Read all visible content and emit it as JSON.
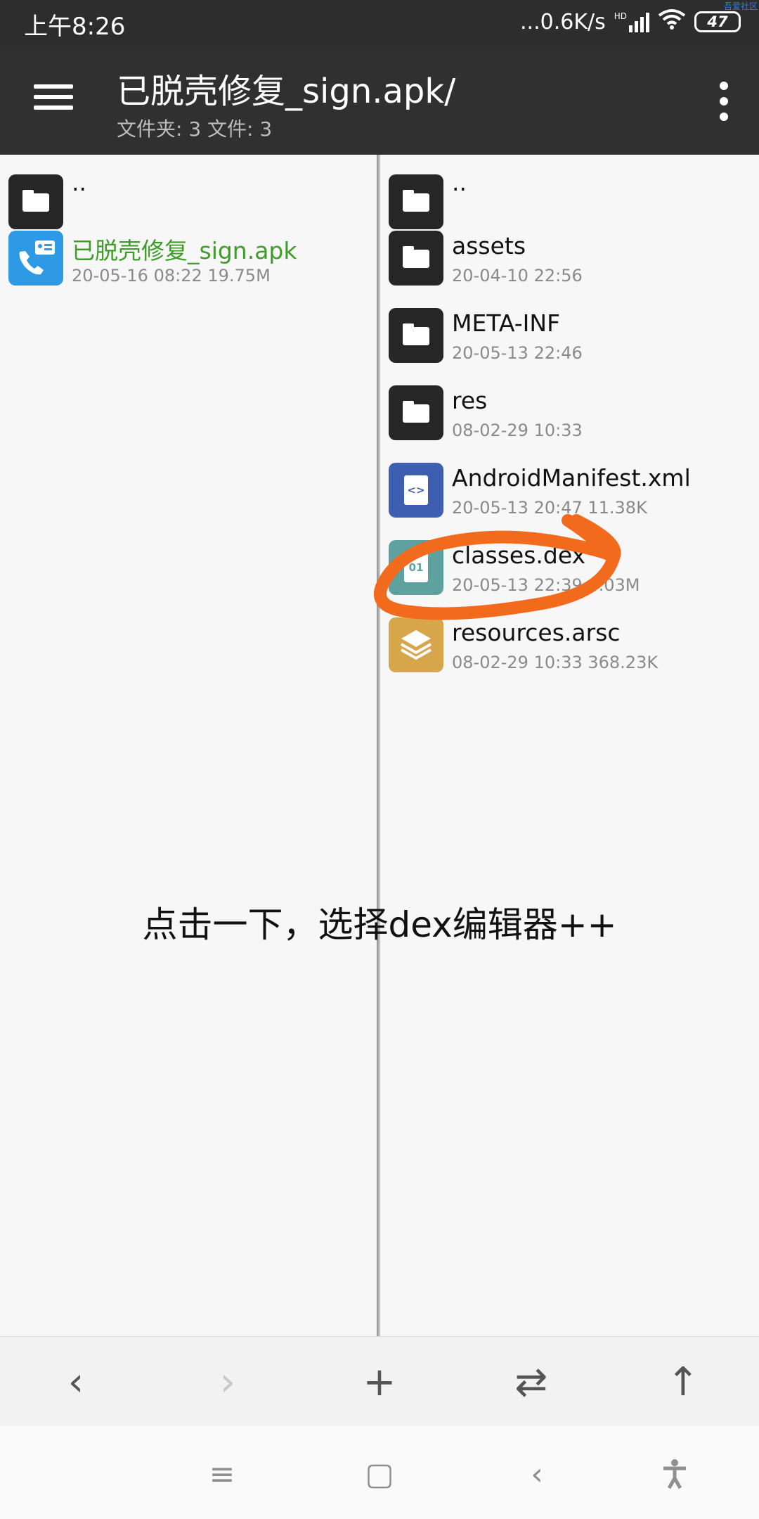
{
  "status_bar": {
    "time": "上午8:26",
    "network_speed": "...0.6K/s",
    "signal_label": "HD",
    "battery": "47",
    "watermark": "吾爱社区"
  },
  "app_bar": {
    "title": "已脱壳修复_sign.apk/",
    "subtitle": "文件夹: 3  文件: 3"
  },
  "left_pane": {
    "entries": [
      {
        "name": "..",
        "meta": "",
        "type": "folder"
      },
      {
        "name": "已脱壳修复_sign.apk",
        "meta": "20-05-16 08:22  19.75M",
        "type": "apk"
      }
    ]
  },
  "right_pane": {
    "entries": [
      {
        "name": "..",
        "meta": "",
        "type": "folder"
      },
      {
        "name": "assets",
        "meta": "20-04-10 22:56",
        "type": "folder"
      },
      {
        "name": "META-INF",
        "meta": "20-05-13 22:46",
        "type": "folder"
      },
      {
        "name": "res",
        "meta": "08-02-29 10:33",
        "type": "folder"
      },
      {
        "name": "AndroidManifest.xml",
        "meta": "20-05-13 20:47  11.38K",
        "type": "xml"
      },
      {
        "name": "classes.dex",
        "meta": "20-05-13 22:39  6.03M",
        "type": "dex"
      },
      {
        "name": "resources.arsc",
        "meta": "08-02-29 10:33  368.23K",
        "type": "arsc"
      }
    ]
  },
  "annotation": {
    "text": "点击一下，选择dex编辑器++",
    "highlight_color": "#f26b1d"
  },
  "toolbar": {
    "back": "‹",
    "forward": "›",
    "add": "+",
    "swap": "⇄",
    "up": "↑"
  },
  "nav_bar": {
    "menu": "≡",
    "home": "▢",
    "back": "‹"
  },
  "colors": {
    "app_bar": "#303030",
    "status_bar": "#2d2d2d",
    "apk_name": "#3f9b2a",
    "xml_icon": "#3e5fb1",
    "dex_icon": "#5fa19f",
    "arsc_icon": "#d7a54a"
  }
}
